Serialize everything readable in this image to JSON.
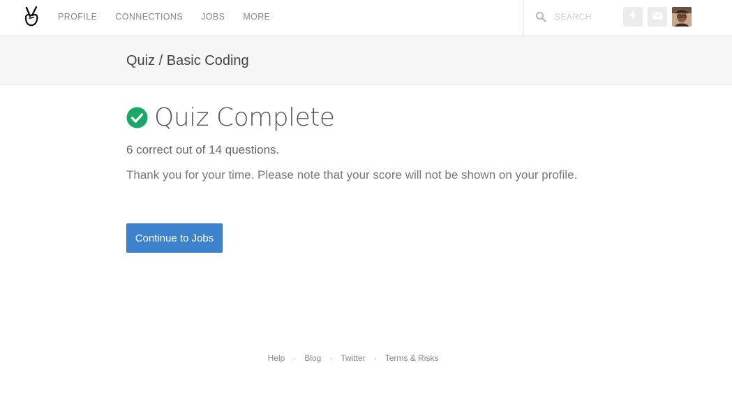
{
  "nav": {
    "items": [
      {
        "label": "PROFILE"
      },
      {
        "label": "CONNECTIONS"
      },
      {
        "label": "JOBS"
      },
      {
        "label": "MORE"
      }
    ],
    "search_placeholder": "SEARCH",
    "icons": {
      "logo": "peace-hand-logo-icon",
      "search": "search-icon",
      "activity": "lightning-icon",
      "messages": "envelope-icon",
      "avatar": "user-avatar"
    }
  },
  "breadcrumb": {
    "title": "Quiz / Basic Coding"
  },
  "result": {
    "heading": "Quiz Complete",
    "score_text": "6 correct out of 14 questions.",
    "note": "Thank you for your time. Please note that your score will not be shown on your profile.",
    "continue_label": "Continue to Jobs",
    "check_color": "#1aa866"
  },
  "footer": {
    "links": [
      "Help",
      "Blog",
      "Twitter",
      "Terms & Risks"
    ],
    "separator": "·"
  },
  "colors": {
    "accent_button": "#3d82cc",
    "band_background": "#f6f6f6"
  }
}
